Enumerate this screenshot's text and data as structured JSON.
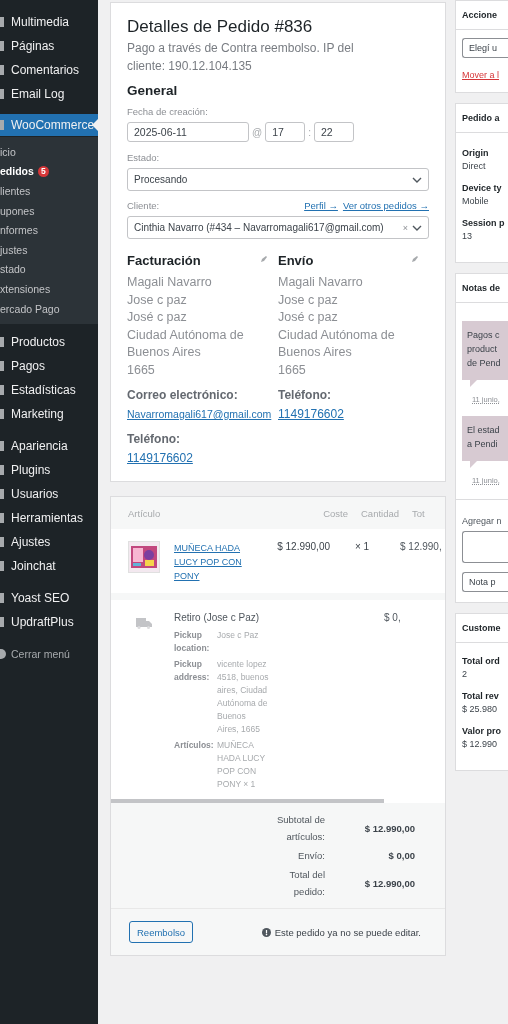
{
  "sidebar": {
    "groups": [
      {
        "items": [
          {
            "label": "Multimedia",
            "selected": false
          },
          {
            "label": "Páginas",
            "selected": false
          },
          {
            "label": "Comentarios",
            "selected": false
          },
          {
            "label": "Email Log",
            "selected": false
          }
        ]
      },
      {
        "items": [
          {
            "label": "WooCommerce",
            "selected": true,
            "children": [
              {
                "label": "icio",
                "selected": false
              },
              {
                "label": "edidos",
                "selected": true,
                "badge": "5"
              },
              {
                "label": "lientes",
                "selected": false
              },
              {
                "label": "upones",
                "selected": false
              },
              {
                "label": "nformes",
                "selected": false
              },
              {
                "label": "justes",
                "selected": false
              },
              {
                "label": "stado",
                "selected": false
              },
              {
                "label": "xtensiones",
                "selected": false
              },
              {
                "label": "ercado Pago",
                "selected": false
              }
            ]
          },
          {
            "label": "Productos",
            "selected": false
          },
          {
            "label": "Pagos",
            "selected": false
          },
          {
            "label": "Estadísticas",
            "selected": false
          },
          {
            "label": "Marketing",
            "selected": false
          }
        ]
      },
      {
        "items": [
          {
            "label": "Apariencia",
            "selected": false
          },
          {
            "label": "Plugins",
            "selected": false
          },
          {
            "label": "Usuarios",
            "selected": false
          },
          {
            "label": "Herramientas",
            "selected": false
          },
          {
            "label": "Ajustes",
            "selected": false
          },
          {
            "label": "Joinchat",
            "selected": false
          }
        ]
      },
      {
        "items": [
          {
            "label": "Yoast SEO",
            "selected": false
          },
          {
            "label": "UpdraftPlus",
            "selected": false
          }
        ]
      }
    ],
    "collapse": "Cerrar menú"
  },
  "order": {
    "title": "Detalles de Pedido #836",
    "subtitle": "Pago a través de Contra reembolso. IP del cliente: 190.12.104.135",
    "general": "General",
    "date_label": "Fecha de creación:",
    "date": "2025-06-11",
    "at": "@",
    "hour": "17",
    "colon": ":",
    "minute": "22",
    "status_label": "Estado:",
    "status": "Procesando",
    "customer_label": "Cliente:",
    "links": [
      "Perfil →",
      "Ver otros pedidos →"
    ],
    "customer": "Cinthia Navarro (#434 – Navarromagali617@gmail.com)",
    "clear": "×",
    "billing": {
      "heading": "Facturación",
      "lines": [
        "Magali Navarro",
        "Jose c paz",
        "José c paz",
        "Ciudad Autónoma de Buenos Aires",
        "1665"
      ],
      "fields": [
        {
          "label": "Correo electrónico:",
          "value": "Navarromagali617@gmail.com"
        },
        {
          "label": "Teléfono:",
          "value": "1149176602"
        }
      ]
    },
    "shipping": {
      "heading": "Envío",
      "lines": [
        "Magali Navarro",
        "Jose c paz",
        "José c paz",
        "Ciudad Autónoma de Buenos Aires",
        "1665"
      ],
      "fields": [
        {
          "label": "Teléfono:",
          "value": "1149176602"
        }
      ]
    }
  },
  "items": {
    "columns": [
      "Artículo",
      "Coste",
      "Cantidad",
      "Tot"
    ],
    "rows": [
      {
        "name": "MUÑECA HADA LUCY POP CON PONY",
        "cost": "$ 12.990,00",
        "qty": "× 1",
        "total": "$ 12.990,"
      }
    ],
    "shipping_line": {
      "name": "Retiro (Jose c Paz)",
      "total": "$ 0,",
      "meta": [
        {
          "label": "Pickup location:",
          "value": "Jose c Paz"
        },
        {
          "label": "Pickup address:",
          "value": "vicente lopez 4518, buenos aires, Ciudad Autónoma de Buenos Aires, 1665"
        },
        {
          "label": "Artículos:",
          "value": "MUÑECA HADA LUCY POP CON PONY × 1"
        }
      ]
    },
    "totals": [
      {
        "label": "Subtotal de artículos:",
        "value": "$ 12.990,00"
      },
      {
        "label": "Envío:",
        "value": "$ 0,00"
      },
      {
        "label": "Total del pedido:",
        "value": "$ 12.990,00"
      }
    ],
    "refund_button": "Reembolso",
    "notice": "Este pedido ya no se puede editar."
  },
  "right": {
    "actions": {
      "title": "Accione",
      "select": "Elegí u",
      "link": "Mover a l"
    },
    "attribution": {
      "title": "Pedido a",
      "fields": [
        {
          "label": "Origin",
          "value": "Direct"
        },
        {
          "label": "Device ty",
          "value": "Mobile"
        },
        {
          "label": "Session p",
          "value": "13"
        }
      ]
    },
    "notes": {
      "title": "Notas de",
      "notes": [
        {
          "lines": [
            "Pagos c",
            "product",
            "de Pend"
          ],
          "date": "11 junio,"
        },
        {
          "lines": [
            "El estad",
            "a Pendi"
          ],
          "date": "11 junio,"
        }
      ],
      "add_label": "Agregar n",
      "note_type": "Nota p"
    },
    "customer_history": {
      "title": "Custome",
      "fields": [
        {
          "label": "Total ord",
          "value": "2"
        },
        {
          "label": "Total rev",
          "value": "$ 25.980"
        },
        {
          "label": "Valor pro",
          "value": "$ 12.990"
        }
      ]
    }
  }
}
